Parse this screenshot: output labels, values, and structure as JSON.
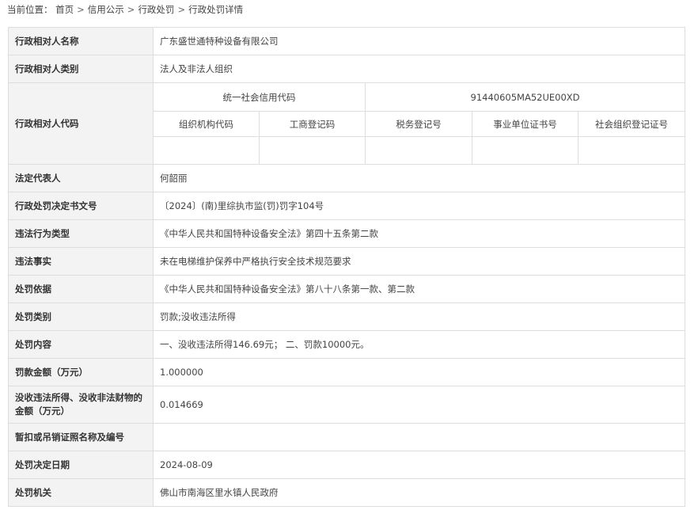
{
  "breadcrumb": {
    "prefix": "当前位置：",
    "items": [
      "首页",
      "信用公示",
      "行政处罚",
      "行政处罚详情"
    ],
    "separator": ">"
  },
  "rows": {
    "name": {
      "label": "行政相对人名称",
      "value": "广东盛世通特种设备有限公司"
    },
    "category": {
      "label": "行政相对人类别",
      "value": "法人及非法人组织"
    },
    "code": {
      "label": "行政相对人代码",
      "uscc_label": "统一社会信用代码",
      "uscc_value": "91440605MA52UE00XD",
      "sub_headers": [
        "组织机构代码",
        "工商登记码",
        "税务登记号",
        "事业单位证书号",
        "社会组织登记证号"
      ]
    },
    "legal_rep": {
      "label": "法定代表人",
      "value": "何韶丽"
    },
    "decision_no": {
      "label": "行政处罚决定书文号",
      "value": "〔2024〕(南)里综执市监(罚)罚字104号"
    },
    "violation_type": {
      "label": "违法行为类型",
      "value": "《中华人民共和国特种设备安全法》第四十五条第二款"
    },
    "facts": {
      "label": "违法事实",
      "value": "未在电梯维护保养中严格执行安全技术规范要求"
    },
    "basis": {
      "label": "处罚依据",
      "value": "《中华人民共和国特种设备安全法》第八十八条第一款、第二款"
    },
    "penalty_type": {
      "label": "处罚类别",
      "value": "罚款;没收违法所得"
    },
    "penalty_content": {
      "label": "处罚内容",
      "value": "一、没收违法所得146.69元； 二、罚款10000元。"
    },
    "fine_amount": {
      "label": "罚款金额（万元）",
      "value": "1.000000"
    },
    "confiscation": {
      "label": "没收违法所得、没收非法财物的金额（万元）",
      "value": "0.014669"
    },
    "license": {
      "label": "暂扣或吊销证照名称及编号",
      "value": ""
    },
    "decision_date": {
      "label": "处罚决定日期",
      "value": "2024-08-09"
    },
    "authority": {
      "label": "处罚机关",
      "value": "佛山市南海区里水镇人民政府"
    }
  }
}
